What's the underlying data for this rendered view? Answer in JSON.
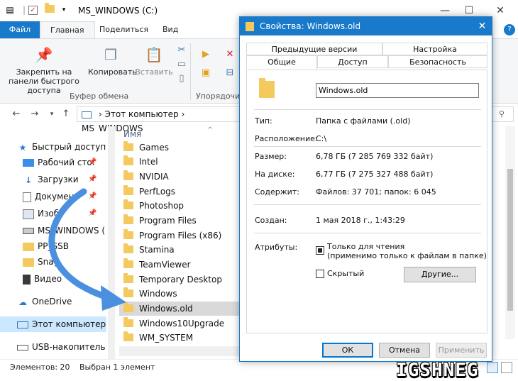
{
  "window": {
    "title": "MS_WINDOWS (C:)",
    "controls": [
      "—",
      "☐",
      "✕"
    ]
  },
  "ribbon": {
    "tabs": [
      "Файл",
      "Главная",
      "Поделиться",
      "Вид"
    ],
    "buttons": {
      "pin": "Закрепить на панели быстрого доступа",
      "copy": "Копировать",
      "paste": "Вставить"
    },
    "groups": {
      "clipboard": "Буфер обмена",
      "organize": "Упорядочи"
    }
  },
  "address": {
    "segments": [
      "Этот компьютер",
      "MS_WINDOWS"
    ]
  },
  "navpane": {
    "items": [
      {
        "label": "Быстрый доступ",
        "icon": "star-icon"
      },
      {
        "label": "Рабочий сто.",
        "icon": "desktop-icon"
      },
      {
        "label": "Загрузки",
        "icon": "download-icon"
      },
      {
        "label": "Документ",
        "icon": "document-icon"
      },
      {
        "label": "Изоб",
        "icon": "pictures-icon"
      },
      {
        "label": "MS_WINDOWS (",
        "icon": "drive-icon"
      },
      {
        "label": "PP_SSB",
        "icon": "folder-icon"
      },
      {
        "label": "Snag",
        "icon": "folder-icon"
      },
      {
        "label": "Видео",
        "icon": "video-icon"
      },
      {
        "label": "OneDrive",
        "icon": "cloud-icon"
      },
      {
        "label": "Этот компьютер",
        "icon": "computer-icon"
      },
      {
        "label": "USB-накопитель",
        "icon": "usb-icon"
      }
    ]
  },
  "filelist": {
    "column_name": "Имя",
    "files": [
      "Games",
      "Intel",
      "NVIDIA",
      "PerfLogs",
      "Photoshop",
      "Program Files",
      "Program Files (x86)",
      "Stamina",
      "TeamViewer",
      "Temporary Desktop",
      "Windows",
      "Windows.old",
      "Windows10Upgrade",
      "WM_SYSTEM"
    ],
    "selected": "Windows.old"
  },
  "status": {
    "items": "Элементов: 20",
    "selected": "Выбран 1 элемент"
  },
  "dialog": {
    "title": "Свойства: Windows.old",
    "tabs_row1": [
      "Предыдущие версии",
      "Настройка"
    ],
    "tabs_row2": [
      "Общие",
      "Доступ",
      "Безопасность"
    ],
    "name": "Windows.old",
    "type_label": "Тип:",
    "type_value": "Папка с файлами (.old)",
    "location_label": "Расположение:",
    "location_value": "C:\\",
    "size_label": "Размер:",
    "size_value": "6,78 ГБ (7 285 769 332 байт)",
    "disk_label": "На диске:",
    "disk_value": "6,77 ГБ (7 275 327 488 байт)",
    "contains_label": "Содержит:",
    "contains_value": "Файлов: 37 701; папок: 6 045",
    "created_label": "Создан:",
    "created_value": "1 мая 2018 г., 1:43:29",
    "attributes_label": "Атрибуты:",
    "readonly_label": "Только для чтения",
    "readonly_sub": "(применимо только к файлам в папке)",
    "hidden_label": "Скрытый",
    "other_button": "Другие...",
    "ok": "ОК",
    "cancel": "Отмена",
    "apply": "Применить"
  },
  "watermark": "IGSHNEG",
  "colors": {
    "accent": "#1979ca",
    "arrow": "#4a8fe0",
    "folder": "#f4c95d"
  }
}
